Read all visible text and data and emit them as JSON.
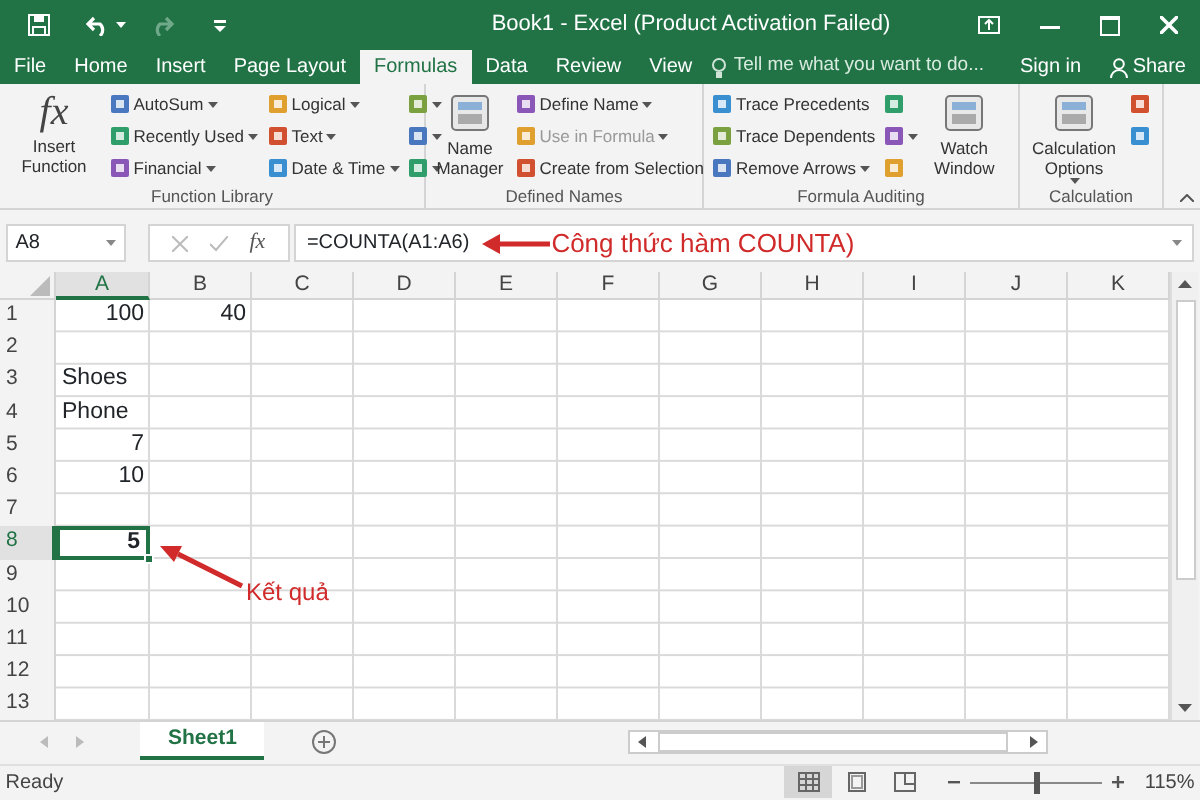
{
  "title_bar": {
    "title": "Book1 - Excel (Product Activation Failed)"
  },
  "tabs": [
    {
      "label": "File",
      "selected": false
    },
    {
      "label": "Home",
      "selected": false
    },
    {
      "label": "Insert",
      "selected": false
    },
    {
      "label": "Page Layout",
      "selected": false
    },
    {
      "label": "Formulas",
      "selected": true
    },
    {
      "label": "Data",
      "selected": false
    },
    {
      "label": "Review",
      "selected": false
    },
    {
      "label": "View",
      "selected": false
    }
  ],
  "tell_me": {
    "placeholder": "Tell me what you want to do..."
  },
  "account": {
    "sign_in": "Sign in",
    "share": "Share"
  },
  "ribbon_groups": [
    {
      "label": "Function Library",
      "columns": [
        [
          {
            "kind": "large",
            "icon_text": "fx",
            "label": "Insert Function",
            "dropdown": false
          }
        ],
        [
          {
            "kind": "small",
            "label": "AutoSum",
            "dropdown": true,
            "disabled": false
          },
          {
            "kind": "small",
            "label": "Recently Used",
            "dropdown": true,
            "disabled": false
          },
          {
            "kind": "small",
            "label": "Financial",
            "dropdown": true,
            "disabled": false
          }
        ],
        [
          {
            "kind": "small",
            "label": "Logical",
            "dropdown": true,
            "disabled": false
          },
          {
            "kind": "small",
            "label": "Text",
            "dropdown": true,
            "disabled": false
          },
          {
            "kind": "small",
            "label": "Date & Time",
            "dropdown": true,
            "disabled": false
          }
        ],
        [
          {
            "kind": "icon",
            "dropdown": true
          },
          {
            "kind": "icon",
            "dropdown": true
          },
          {
            "kind": "icon",
            "dropdown": true
          }
        ]
      ]
    },
    {
      "label": "Defined Names",
      "columns": [
        [
          {
            "kind": "large",
            "label": "Name Manager",
            "dropdown": false
          }
        ],
        [
          {
            "kind": "small",
            "label": "Define Name",
            "dropdown": true,
            "disabled": false
          },
          {
            "kind": "small",
            "label": "Use in Formula",
            "dropdown": true,
            "disabled": true
          },
          {
            "kind": "small",
            "label": "Create from Selection",
            "dropdown": false,
            "disabled": false
          }
        ]
      ]
    },
    {
      "label": "Formula Auditing",
      "columns": [
        [
          {
            "kind": "small",
            "label": "Trace Precedents",
            "dropdown": false,
            "disabled": false
          },
          {
            "kind": "small",
            "label": "Trace Dependents",
            "dropdown": false,
            "disabled": false
          },
          {
            "kind": "small",
            "label": "Remove Arrows",
            "dropdown": true,
            "disabled": false
          }
        ],
        [
          {
            "kind": "icon",
            "dropdown": false
          },
          {
            "kind": "icon",
            "dropdown": true
          },
          {
            "kind": "icon",
            "dropdown": false
          }
        ],
        [
          {
            "kind": "large",
            "label": "Watch Window",
            "dropdown": false
          }
        ]
      ]
    },
    {
      "label": "Calculation",
      "columns": [
        [
          {
            "kind": "large",
            "label": "Calculation Options",
            "dropdown": true
          }
        ],
        [
          {
            "kind": "icon",
            "dropdown": false
          },
          {
            "kind": "icon",
            "dropdown": false
          }
        ]
      ]
    }
  ],
  "formula_bar": {
    "name_box": "A8",
    "fx": "fx",
    "formula": "=COUNTA(A1:A6)"
  },
  "annotations": [
    {
      "kind": "formula",
      "text": "Công thức hàm COUNTA)"
    },
    {
      "kind": "result",
      "text": "Kết quả"
    }
  ],
  "sheet": {
    "columns": [
      {
        "label": "A",
        "selected": true
      },
      {
        "label": "B",
        "selected": false
      },
      {
        "label": "C",
        "selected": false
      },
      {
        "label": "D",
        "selected": false
      },
      {
        "label": "E",
        "selected": false
      },
      {
        "label": "F",
        "selected": false
      },
      {
        "label": "G",
        "selected": false
      },
      {
        "label": "H",
        "selected": false
      },
      {
        "label": "I",
        "selected": false
      },
      {
        "label": "J",
        "selected": false
      },
      {
        "label": "K",
        "selected": false
      }
    ],
    "rows": [
      {
        "label": "1",
        "selected": false,
        "cells": [
          {
            "kind": "number",
            "text": "100",
            "selected": false
          },
          {
            "kind": "number",
            "text": "40",
            "selected": false
          }
        ]
      },
      {
        "label": "2",
        "selected": false
      },
      {
        "label": "3",
        "selected": false,
        "cells": [
          {
            "kind": "text",
            "text": "Shoes",
            "selected": false
          }
        ]
      },
      {
        "label": "4",
        "selected": false,
        "cells": [
          {
            "kind": "text",
            "text": "Phone",
            "selected": false
          }
        ]
      },
      {
        "label": "5",
        "selected": false,
        "cells": [
          {
            "kind": "number",
            "text": "7",
            "selected": false
          }
        ]
      },
      {
        "label": "6",
        "selected": false,
        "cells": [
          {
            "kind": "number",
            "text": "10",
            "selected": false
          }
        ]
      },
      {
        "label": "7",
        "selected": false
      },
      {
        "label": "8",
        "selected": true,
        "cells": [
          {
            "kind": "number",
            "text": "5",
            "selected": true
          }
        ]
      },
      {
        "label": "9",
        "selected": false
      },
      {
        "label": "10",
        "selected": false
      },
      {
        "label": "11",
        "selected": false
      },
      {
        "label": "12",
        "selected": false
      },
      {
        "label": "13",
        "selected": false
      }
    ]
  },
  "sheet_tabs": [
    {
      "label": "Sheet1",
      "selected": true
    }
  ],
  "status_bar": {
    "status": "Ready",
    "views": [
      {
        "selected": true
      },
      {
        "selected": false
      },
      {
        "selected": false
      }
    ],
    "zoom_slider": {
      "level": 0.5
    },
    "zoom": "115%"
  }
}
